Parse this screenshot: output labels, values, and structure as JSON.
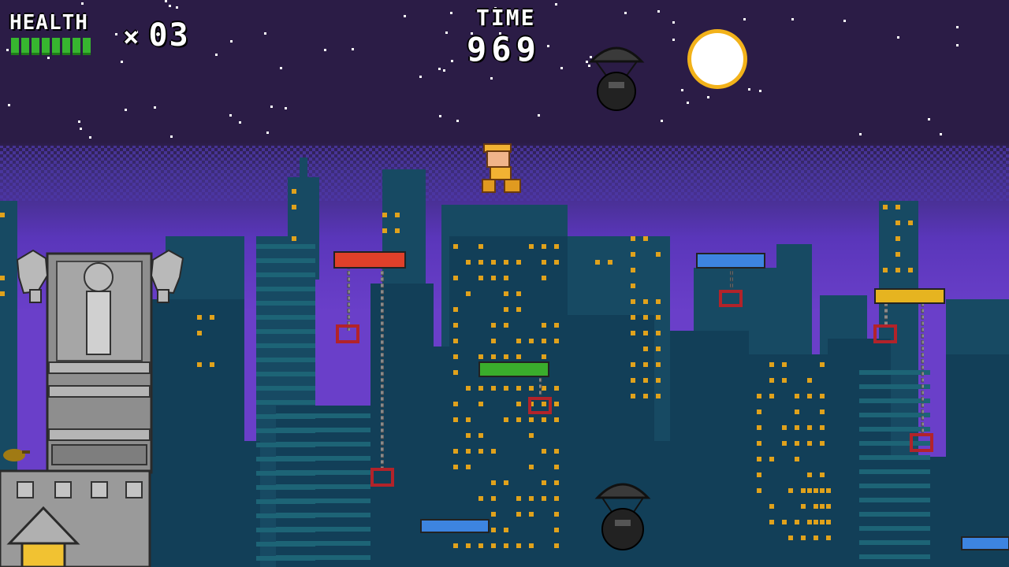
{
  "hud": {
    "health_label": "HEALTH",
    "health_segments_filled": 8,
    "health_segments_total": 8,
    "lives_prefix": "×",
    "lives_value": "03",
    "time_label": "TIME",
    "time_value": "969"
  },
  "colors": {
    "sky": "#2b1c46",
    "horizon": "#6a3fc9",
    "building": "#123f58",
    "building_light": "#1b5569",
    "window": "#e0a21c",
    "moon": "#ffffff",
    "moon_rim": "#f2b21a",
    "health": "#37b62f",
    "platform_red": "#e0402a",
    "platform_blue": "#3d84e0",
    "platform_green": "#3aad2c",
    "platform_yellow": "#e6b420",
    "tower": "#9a9a9a"
  },
  "entities": [
    {
      "name": "player-character",
      "sprite": "hero-with-cap"
    },
    {
      "name": "paratrooper-enemy-top",
      "sprite": "parachute-bomb-enemy"
    },
    {
      "name": "paratrooper-enemy-bottom",
      "sprite": "parachute-bomb-enemy"
    },
    {
      "name": "moon",
      "sprite": "full-moon"
    },
    {
      "name": "stone-tower",
      "sprite": "eagle-column-tower"
    }
  ]
}
